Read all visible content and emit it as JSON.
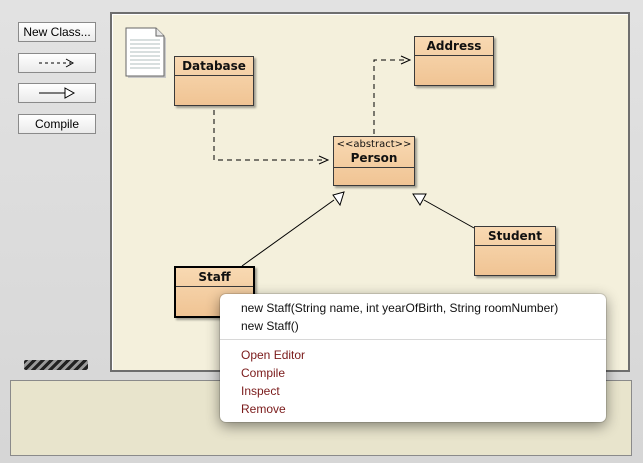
{
  "toolbar": {
    "new_class_label": "New Class...",
    "dependency_arrow_icon": "dashed-arrow-icon",
    "inheritance_arrow_icon": "inheritance-arrow-icon",
    "compile_label": "Compile"
  },
  "diagram": {
    "readme_icon": "readme-document-icon",
    "classes": {
      "database": {
        "name": "Database"
      },
      "address": {
        "name": "Address"
      },
      "person": {
        "name": "Person",
        "stereotype": "<<abstract>>"
      },
      "student": {
        "name": "Student"
      },
      "staff": {
        "name": "Staff"
      }
    }
  },
  "context_menu": {
    "constructors": [
      "new Staff(String name, int yearOfBirth, String roomNumber)",
      "new Staff()"
    ],
    "actions": [
      "Open Editor",
      "Compile",
      "Inspect",
      "Remove"
    ]
  },
  "colors": {
    "class_fill": "#f0c494",
    "canvas_bg": "#f4f0dc",
    "menu_action_text": "#7a1a1a"
  }
}
